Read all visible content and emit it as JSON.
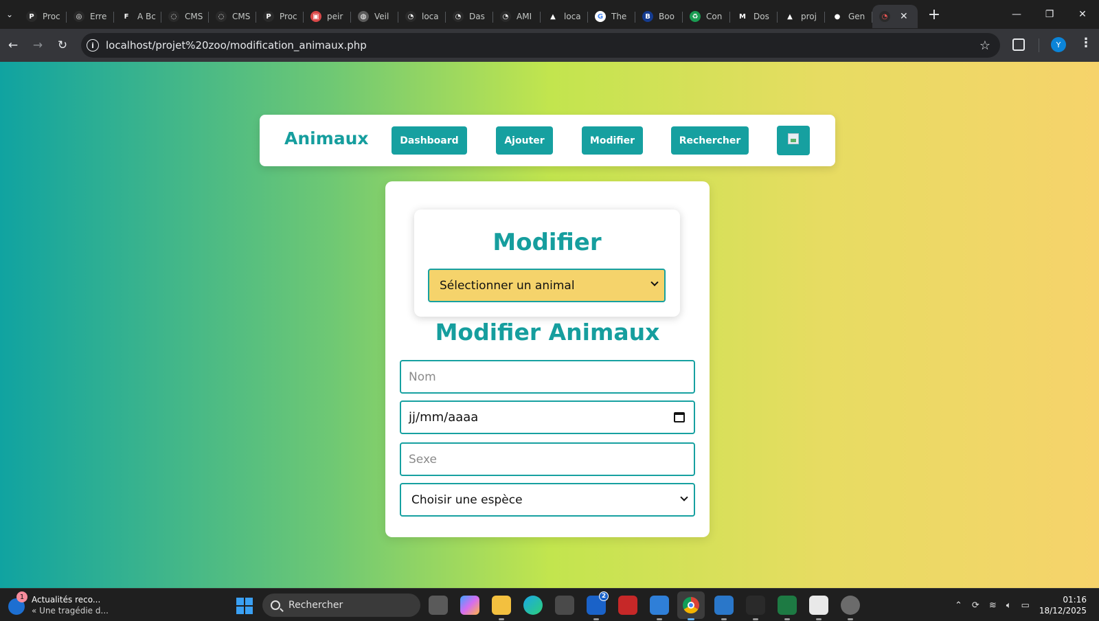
{
  "browser": {
    "tabs": [
      {
        "title": "Proc",
        "fav": "P",
        "color": "#2a2a2a"
      },
      {
        "title": "Erre",
        "fav": "◎",
        "color": "#2a2a2a"
      },
      {
        "title": "A Bc",
        "fav": "F",
        "color": "#1f1f1f"
      },
      {
        "title": "CMS",
        "fav": "◌",
        "color": "#2a2a2a"
      },
      {
        "title": "CMS",
        "fav": "◌",
        "color": "#2a2a2a"
      },
      {
        "title": "Proc",
        "fav": "P",
        "color": "#2a2a2a"
      },
      {
        "title": "peir",
        "fav": "▣",
        "color": "#d94848"
      },
      {
        "title": "Veil",
        "fav": "◍",
        "color": "#5b5b5b"
      },
      {
        "title": "loca",
        "fav": "◔",
        "color": "#2a2a2a"
      },
      {
        "title": "Das",
        "fav": "◔",
        "color": "#2a2a2a"
      },
      {
        "title": "AMI",
        "fav": "◔",
        "color": "#2a2a2a"
      },
      {
        "title": "loca",
        "fav": "▲",
        "color": "#1f1f1f"
      },
      {
        "title": "The",
        "fav": "G",
        "color": "#ffffff"
      },
      {
        "title": "Boo",
        "fav": "B",
        "color": "#143b8f"
      },
      {
        "title": "Con",
        "fav": "♻",
        "color": "#1a9c52"
      },
      {
        "title": "Dos",
        "fav": "M",
        "color": "#1f1f1f"
      },
      {
        "title": "proj",
        "fav": "▲",
        "color": "#1f1f1f"
      },
      {
        "title": "Gen",
        "fav": "●",
        "color": "#1f1f1f"
      }
    ],
    "active_tab_close": "✕",
    "new_tab": "+",
    "url_host": "localhost",
    "url_path": "/projet%20zoo/modification_animaux.php",
    "profile_initial": "Y",
    "win_min": "—",
    "win_restore": "❐",
    "win_close": "✕"
  },
  "navbar": {
    "brand": "Animaux",
    "links": [
      "Dashboard",
      "Ajouter",
      "Modifier",
      "Rechercher"
    ]
  },
  "select_card": {
    "title": "Modifier",
    "select_value": "Sélectionner un animal"
  },
  "form": {
    "title": "Modifier Animaux",
    "nom_placeholder": "Nom",
    "date_value": "jj/mm/aaaa",
    "sexe_placeholder": "Sexe",
    "espece_value": "Choisir une espèce"
  },
  "taskbar": {
    "news_badge": "1",
    "news_title": "Actualités reco...",
    "news_sub": "« Une tragédie d...",
    "search_label": "Rechercher",
    "mail_badge": "2",
    "time": "01:16",
    "date": "18/12/2025"
  }
}
